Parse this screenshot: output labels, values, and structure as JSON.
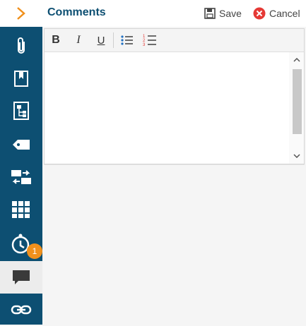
{
  "panel": {
    "title": "Comments",
    "save_label": "Save",
    "cancel_label": "Cancel"
  },
  "sidebar": {
    "items": [
      {
        "icon": "chevron-right-icon"
      },
      {
        "icon": "paperclip-icon"
      },
      {
        "icon": "bookmark-icon"
      },
      {
        "icon": "hierarchy-icon"
      },
      {
        "icon": "tag-icon"
      },
      {
        "icon": "transfer-icon"
      },
      {
        "icon": "grid-icon"
      },
      {
        "icon": "timer-icon",
        "badge": "1"
      },
      {
        "icon": "comment-icon",
        "active": true
      },
      {
        "icon": "link-icon"
      }
    ]
  },
  "toolbar": {
    "buttons": [
      "bold",
      "italic",
      "underline",
      "bullet-list",
      "numbered-list"
    ]
  },
  "editor": {
    "value": ""
  },
  "colors": {
    "sidebar": "#0d4f72",
    "accent": "#f0901c",
    "cancel": "#e53935"
  }
}
